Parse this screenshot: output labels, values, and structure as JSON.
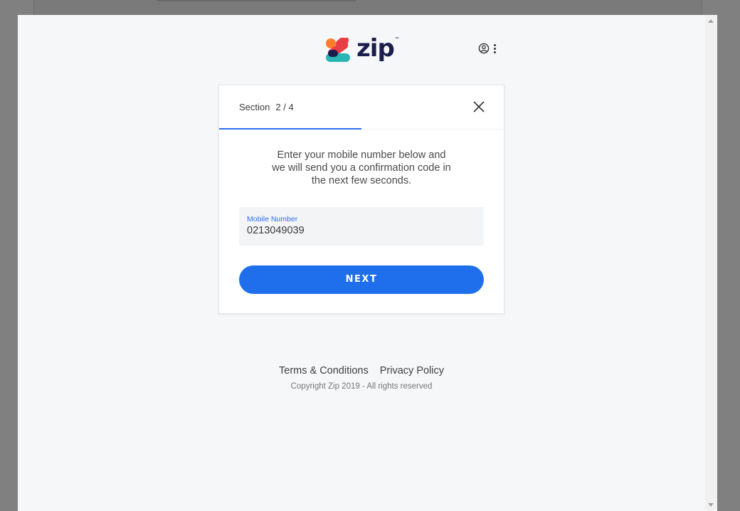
{
  "brand": {
    "name": "zip",
    "trademark": "™",
    "colors": {
      "orange": "#ff7c2a",
      "red": "#e93e45",
      "teal": "#2ab5b5",
      "navy": "#1b1d4d",
      "accent": "#1f6fec"
    }
  },
  "header": {
    "user_icon": "user-circle-icon",
    "menu_icon": "kebab-menu-icon"
  },
  "card": {
    "section_word": "Section",
    "section_progress": "2 / 4",
    "progress_fraction": 0.5,
    "close_icon": "close-icon",
    "intro_line1": "Enter your mobile number below and",
    "intro_line2": "we will send you a confirmation code in",
    "intro_line3": "the next few seconds.",
    "mobile_label": "Mobile Number",
    "mobile_value": "0213049039",
    "next_label": "NEXT"
  },
  "footer": {
    "terms": "Terms & Conditions",
    "privacy": "Privacy Policy",
    "copyright": "Copyright Zip 2019 - All rights reserved"
  }
}
